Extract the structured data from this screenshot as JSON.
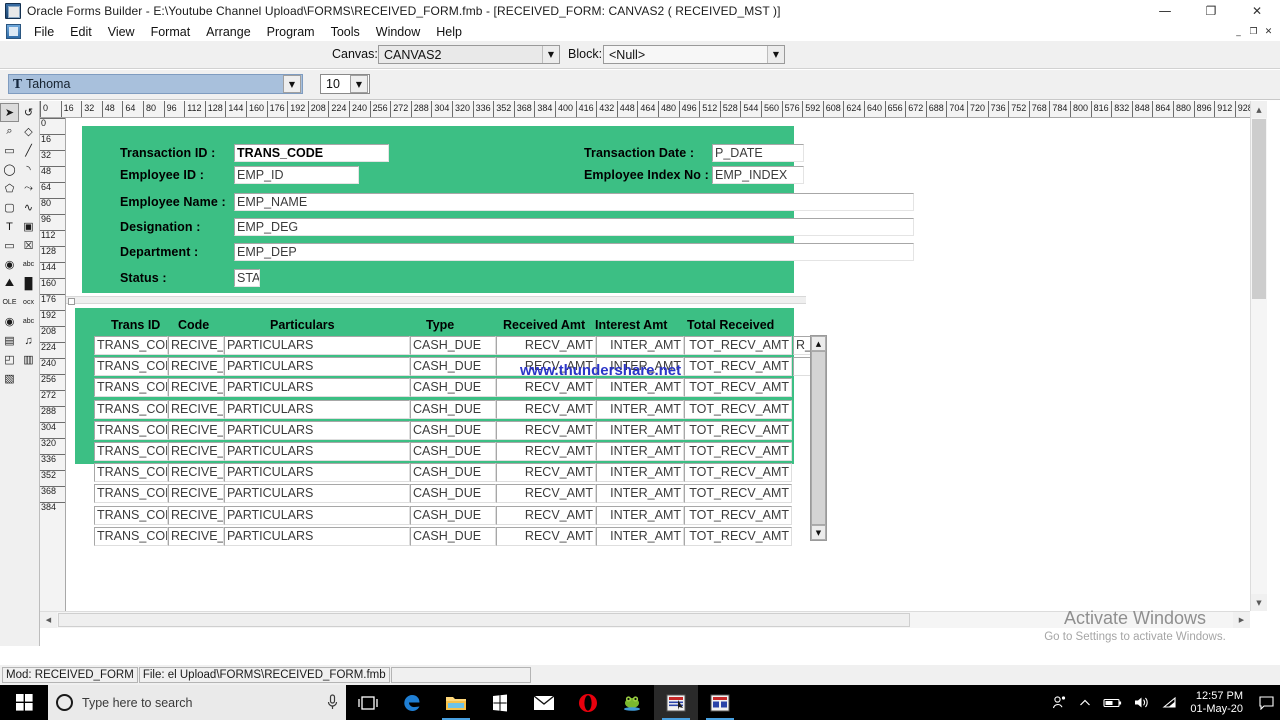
{
  "window": {
    "title": "Oracle Forms Builder - E:\\Youtube Channel Upload\\FORMS\\RECEIVED_FORM.fmb - [RECEIVED_FORM: CANVAS2 ( RECEIVED_MST )]",
    "minimize": "—",
    "restore": "❐",
    "close": "✕",
    "mdi_minimize": "_",
    "mdi_restore": "❐",
    "mdi_close": "✕"
  },
  "menu": {
    "items": [
      "File",
      "Edit",
      "View",
      "Format",
      "Arrange",
      "Program",
      "Tools",
      "Window",
      "Help"
    ]
  },
  "toolbar": {
    "canvas_label": "Canvas:",
    "canvas_value": "CANVAS2",
    "block_label": "Block:",
    "block_value": "<Null>",
    "font_name": "Tahoma",
    "font_size": "10",
    "dropdown_arrow": "▼"
  },
  "palette": {
    "tools": [
      {
        "name": "select-arrow-tool",
        "glyph": "➤"
      },
      {
        "name": "rotate-tool",
        "glyph": "↺"
      },
      {
        "name": "magnify-tool",
        "glyph": "⌕"
      },
      {
        "name": "reshape-tool",
        "glyph": "◇"
      },
      {
        "name": "rectangle-tool",
        "glyph": "▭"
      },
      {
        "name": "line-tool",
        "glyph": "╱"
      },
      {
        "name": "ellipse-tool",
        "glyph": "◯"
      },
      {
        "name": "arc-tool",
        "glyph": "◝"
      },
      {
        "name": "polygon-tool",
        "glyph": "⬠"
      },
      {
        "name": "polyline-tool",
        "glyph": "⤳"
      },
      {
        "name": "rounded-rectangle-tool",
        "glyph": "▢"
      },
      {
        "name": "freehand-tool",
        "glyph": "∿"
      },
      {
        "name": "text-tool",
        "glyph": "T"
      },
      {
        "name": "frame-tool",
        "glyph": "▣"
      },
      {
        "name": "button-tool",
        "glyph": "▭"
      },
      {
        "name": "checkbox-tool",
        "glyph": "☒"
      },
      {
        "name": "radio-button-tool",
        "glyph": "◉"
      },
      {
        "name": "display-item-tool",
        "glyph": "abc"
      },
      {
        "name": "image-item-tool",
        "glyph": "⛰"
      },
      {
        "name": "chart-item-tool",
        "glyph": "█"
      },
      {
        "name": "ole-container-tool",
        "glyph": "OLE"
      },
      {
        "name": "activex-control-tool",
        "glyph": "ocx"
      },
      {
        "name": "visual-attribute-tool",
        "glyph": "◉"
      },
      {
        "name": "text-item-tool",
        "glyph": "abc"
      },
      {
        "name": "list-item-tool",
        "glyph": "▤"
      },
      {
        "name": "sound-item-tool",
        "glyph": "♫"
      },
      {
        "name": "stacked-canvas-tool",
        "glyph": "◰"
      },
      {
        "name": "tab-canvas-tool",
        "glyph": "▥"
      },
      {
        "name": "window-tool",
        "glyph": "▧"
      }
    ]
  },
  "rulers": {
    "horizontal": [
      "0",
      "16",
      "32",
      "48",
      "64",
      "80",
      "96",
      "112",
      "128",
      "144",
      "160",
      "176",
      "192",
      "208",
      "224",
      "240",
      "256",
      "272",
      "288",
      "304",
      "320",
      "336",
      "352",
      "368",
      "384",
      "400",
      "416",
      "432",
      "448",
      "464",
      "480",
      "496",
      "512",
      "528",
      "544",
      "560",
      "576",
      "592",
      "608",
      "624",
      "640",
      "656",
      "672",
      "688",
      "704",
      "720",
      "736",
      "752",
      "768",
      "784",
      "800",
      "816",
      "832",
      "848",
      "864",
      "880",
      "896",
      "912",
      "928",
      "9"
    ],
    "vertical": [
      "0",
      "16",
      "32",
      "48",
      "64",
      "80",
      "96",
      "112",
      "128",
      "144",
      "160",
      "176",
      "192",
      "208",
      "224",
      "240",
      "256",
      "272",
      "288",
      "304",
      "320",
      "336",
      "352",
      "368",
      "384"
    ]
  },
  "form": {
    "header_fields": [
      {
        "label": "Transaction ID :",
        "value": "TRANS_CODE"
      },
      {
        "label": "Employee ID :",
        "value": "EMP_ID"
      },
      {
        "label": "Employee Name :",
        "value": "EMP_NAME"
      },
      {
        "label": "Designation :",
        "value": "EMP_DEG"
      },
      {
        "label": "Department :",
        "value": "EMP_DEP"
      },
      {
        "label": "Status :",
        "value": "STA"
      }
    ],
    "right_fields": [
      {
        "label": "Transaction Date :",
        "value": "P_DATE"
      },
      {
        "label": "Employee Index No :",
        "value": "EMP_INDEX"
      }
    ]
  },
  "grid": {
    "headers": [
      "Trans ID",
      "Code",
      "Particulars",
      "Type",
      "Received Amt",
      "Interest Amt",
      "Total Received"
    ],
    "extra_column_value": "R_S",
    "row_count": 10,
    "row_template": [
      "TRANS_CODE",
      "RECIVE_ID",
      "PARTICULARS",
      "CASH_DUE",
      "RECV_AMT",
      "INTER_AMT",
      "TOT_RECV_AMT"
    ],
    "scroll_up": "▲",
    "scroll_down": "▼"
  },
  "watermark": {
    "canvas_text": "www.thundershare.net",
    "activate_title": "Activate Windows",
    "activate_subtitle": "Go to Settings to activate Windows."
  },
  "statusbar": {
    "module": "Mod: RECEIVED_FORM",
    "file": "File: el Upload\\FORMS\\RECEIVED_FORM.fmb"
  },
  "taskbar": {
    "search_placeholder": "Type here to search",
    "time": "12:57 PM",
    "date": "01-May-20",
    "apps": [
      {
        "name": "task-view-icon",
        "glyph": "❐"
      },
      {
        "name": "edge-browser-icon",
        "glyph": "e"
      },
      {
        "name": "file-explorer-icon",
        "glyph": "📁"
      },
      {
        "name": "microsoft-store-icon",
        "glyph": "⊞"
      },
      {
        "name": "mail-icon",
        "glyph": "✉"
      },
      {
        "name": "opera-browser-icon",
        "glyph": "O"
      },
      {
        "name": "frog-app-icon",
        "glyph": "●"
      },
      {
        "name": "oracle-forms-builder-taskbar-icon",
        "glyph": "▤"
      },
      {
        "name": "oracle-forms-runtime-taskbar-icon",
        "glyph": "▤"
      }
    ],
    "tray": [
      {
        "name": "people-icon",
        "glyph": "⚉"
      },
      {
        "name": "show-hidden-icons-chevron",
        "glyph": "∧"
      },
      {
        "name": "battery-icon",
        "glyph": "▭"
      },
      {
        "name": "volume-icon",
        "glyph": "🔊"
      },
      {
        "name": "network-wifi-icon",
        "glyph": "◢"
      }
    ],
    "action_center": "▭"
  },
  "colors": {
    "canvas_green": "#3cbf84",
    "taskbar_black": "#000000",
    "watermark_blue": "#2b35c8"
  }
}
